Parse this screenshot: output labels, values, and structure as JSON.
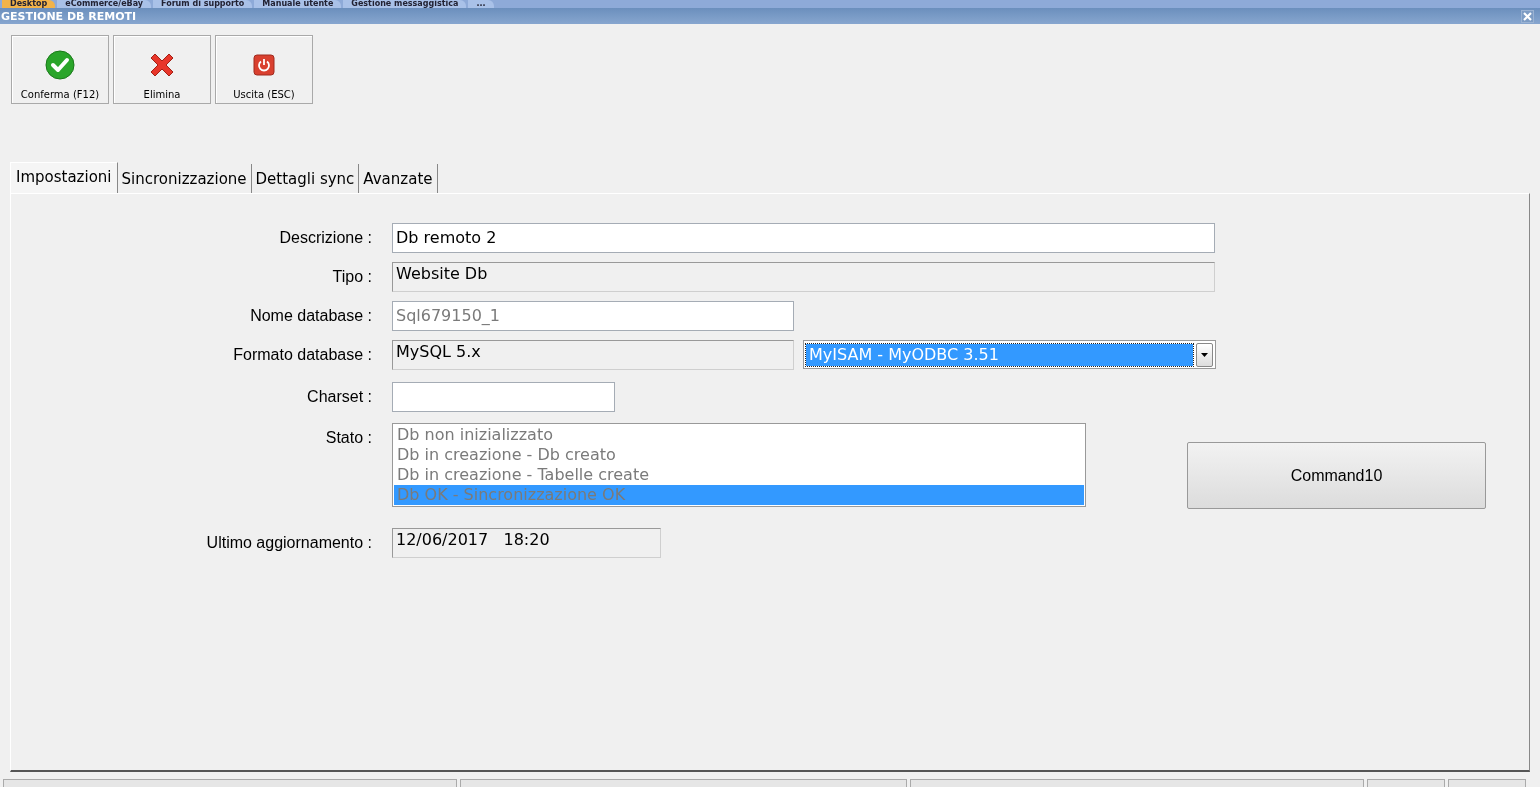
{
  "top_tabs": [
    {
      "label": "Desktop",
      "selected": true
    },
    {
      "label": "eCommerce/eBay",
      "selected": false
    },
    {
      "label": "Forum di supporto",
      "selected": false
    },
    {
      "label": "Manuale utente",
      "selected": false
    },
    {
      "label": "Gestione messaggistica",
      "selected": false
    },
    {
      "label": "...",
      "selected": false
    }
  ],
  "window": {
    "title": "GESTIONE DB REMOTI"
  },
  "toolbar": [
    {
      "label": "Conferma (F12)",
      "kind": "confirm"
    },
    {
      "label": "Elimina",
      "kind": "delete"
    },
    {
      "label": "Uscita (ESC)",
      "kind": "exit"
    }
  ],
  "tabs": [
    {
      "label": "Impostazioni",
      "selected": true
    },
    {
      "label": "Sincronizzazione",
      "selected": false
    },
    {
      "label": "Dettagli sync",
      "selected": false
    },
    {
      "label": "Avanzate",
      "selected": false
    }
  ],
  "descrizione": {
    "label": "Descrizione :",
    "value": "Db remoto 2",
    "readonly": false,
    "disabled": false
  },
  "tipo": {
    "label": "Tipo :",
    "value": "Website Db",
    "readonly": true,
    "disabled": false
  },
  "nome_database": {
    "label": "Nome database :",
    "value": "Sql679150_1",
    "readonly": false,
    "disabled": true
  },
  "formato_database": {
    "label": "Formato database :",
    "value": "MySQL 5.x",
    "readonly": true,
    "disabled": false,
    "combo": {
      "value": "MyISAM - MyODBC 3.51",
      "highlighted": true
    }
  },
  "charset": {
    "label": "Charset :",
    "readonly": false
  },
  "stato": {
    "label": "Stato :",
    "disabled": true,
    "items": [
      {
        "label": "Db non inizializzato",
        "selected": false
      },
      {
        "label": "Db in creazione - Db creato",
        "selected": false
      },
      {
        "label": "Db in creazione - Tabelle create",
        "selected": false
      },
      {
        "label": "Db OK - Sincronizzazione OK",
        "selected": true
      }
    ]
  },
  "command_button": {
    "label": "Command10"
  },
  "ultimo_aggiornamento": {
    "label": "Ultimo aggiornamento :",
    "value": "12/06/2017   18:20",
    "readonly": true,
    "disabled": false
  }
}
